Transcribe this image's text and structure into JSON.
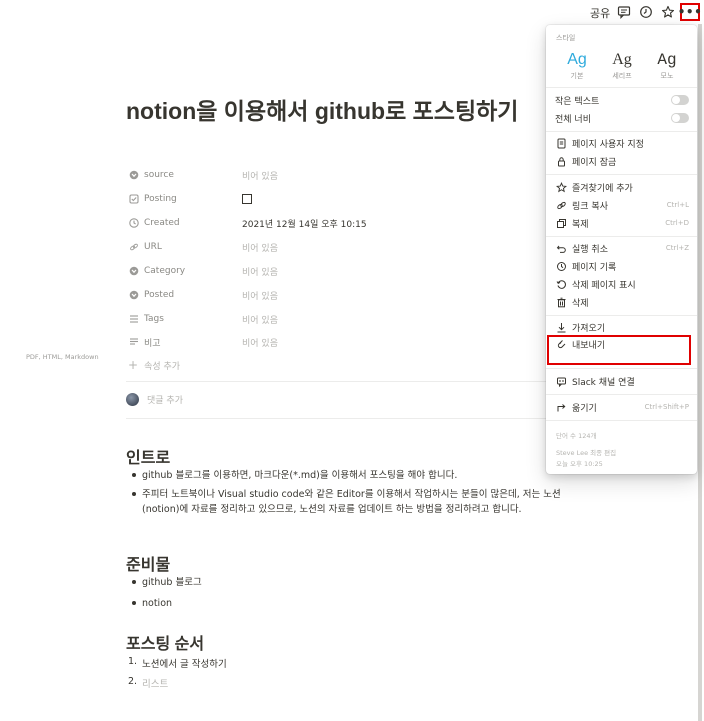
{
  "topbar": {
    "share": "공유",
    "icons": [
      "comment-icon",
      "clock-icon",
      "star-icon",
      "more-icon"
    ],
    "more_label": "•••"
  },
  "page": {
    "title": "notion을 이용해서 github로 포스팅하기",
    "properties": [
      {
        "name": "source",
        "value": "비어 있음",
        "icon": "circle-down-icon",
        "empty": true
      },
      {
        "name": "Posting",
        "value": "",
        "icon": "checkbox-icon",
        "empty": false,
        "checkbox": true
      },
      {
        "name": "Created",
        "value": "2021년 12월 14일 오후 10:15",
        "icon": "clock-icon",
        "empty": false
      },
      {
        "name": "URL",
        "value": "비어 있음",
        "icon": "link-icon",
        "empty": true
      },
      {
        "name": "Category",
        "value": "비어 있음",
        "icon": "circle-down-icon",
        "empty": true
      },
      {
        "name": "Posted",
        "value": "비어 있음",
        "icon": "circle-down-icon",
        "empty": true
      },
      {
        "name": "Tags",
        "value": "비어 있음",
        "icon": "list-icon",
        "empty": true
      },
      {
        "name": "비고",
        "value": "비어 있음",
        "icon": "text-icon",
        "empty": true
      }
    ],
    "add_property": "속성 추가",
    "add_comment": "댓글 추가",
    "sections": {
      "intro": {
        "heading": "인트로",
        "bullets": [
          "github 블로그를 이용하면, 마크다운(*.md)을 이용해서 포스팅을 해야 합니다.",
          "주피터 노트북이나 Visual studio code와 같은 Editor를 이용해서 작업하시는 분들이 많은데, 저는 노션(notion)에 자료를 정리하고 있으므로, 노션의 자료를 업데이트 하는 방법을 정리하려고 합니다."
        ]
      },
      "prep": {
        "heading": "준비물",
        "bullets": [
          "github 블로그",
          "notion"
        ]
      },
      "order": {
        "heading": "포스팅 순서",
        "items": [
          {
            "n": "1.",
            "text": "노션에서 글 작성하기"
          },
          {
            "n": "2.",
            "text": "리스트"
          }
        ]
      }
    }
  },
  "menu": {
    "style_label": "스타일",
    "styles": [
      {
        "glyph": "Ag",
        "name": "기본",
        "selected": true
      },
      {
        "glyph": "Ag",
        "name": "세리프",
        "selected": false
      },
      {
        "glyph": "Ag",
        "name": "모노",
        "selected": false
      }
    ],
    "small_text": "작은 텍스트",
    "full_width": "전체 너비",
    "customize_page": "페이지 사용자 지정",
    "lock_page": "페이지 잠금",
    "add_favorite": "즐겨찾기에 추가",
    "copy_link": "링크 복사",
    "copy_link_sc": "Ctrl+L",
    "duplicate": "복제",
    "duplicate_sc": "Ctrl+D",
    "undo": "실행 취소",
    "undo_sc": "Ctrl+Z",
    "page_history": "페이지 기록",
    "show_deleted": "삭제 페이지 표시",
    "delete": "삭제",
    "import": "가져오기",
    "export": "내보내기",
    "export_sub": "PDF, HTML, Markdown",
    "slack": "Slack 채널 연결",
    "move": "옮기기",
    "move_sc": "Ctrl+Shift+P",
    "word_count": "단어 수 124개",
    "last_edited_by": "Steve Lee 최종 편집",
    "last_edited_time": "오늘 오후 10:25"
  },
  "colors": {
    "accent": "#2eaadc",
    "highlight_box": "#e00000",
    "text": "#37352f",
    "muted": "#b5b4b0"
  }
}
